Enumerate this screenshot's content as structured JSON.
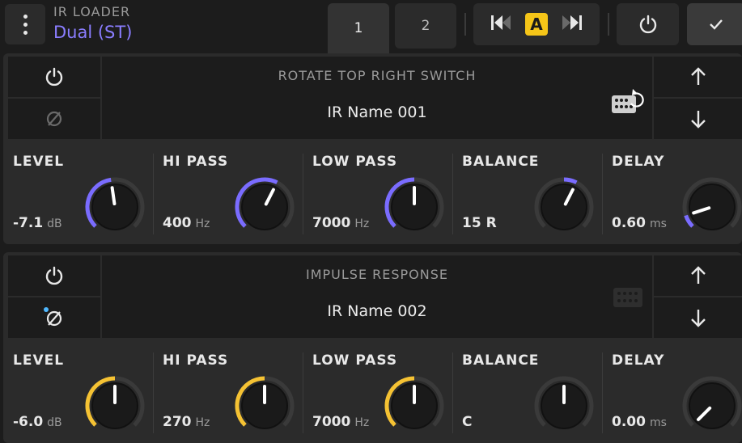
{
  "header": {
    "module_label": "IR LOADER",
    "module_type": "Dual (ST)",
    "tabs": [
      {
        "label": "1",
        "active": true
      },
      {
        "label": "2",
        "active": false
      }
    ],
    "preset_badge": "A"
  },
  "slots": [
    {
      "section_label": "ROTATE TOP RIGHT SWITCH",
      "ir_name": "IR Name 001",
      "phase_active": false,
      "accent": "#7a6cff",
      "knobs": [
        {
          "label": "LEVEL",
          "value": "-7.1",
          "unit": "dB",
          "level": 0.47
        },
        {
          "label": "HI PASS",
          "value": "400",
          "unit": "Hz",
          "level": 0.6
        },
        {
          "label": "LOW PASS",
          "value": "7000",
          "unit": "Hz",
          "level": 0.5
        },
        {
          "label": "BALANCE",
          "value": "15 R",
          "unit": "",
          "level": 0.6
        },
        {
          "label": "DELAY",
          "value": "0.60",
          "unit": "ms",
          "level": 0.1
        }
      ]
    },
    {
      "section_label": "IMPULSE RESPONSE",
      "ir_name": "IR Name 002",
      "phase_active": true,
      "accent": "#f5c233",
      "knobs": [
        {
          "label": "LEVEL",
          "value": "-6.0",
          "unit": "dB",
          "level": 0.5
        },
        {
          "label": "HI PASS",
          "value": "270",
          "unit": "Hz",
          "level": 0.5
        },
        {
          "label": "LOW PASS",
          "value": "7000",
          "unit": "Hz",
          "level": 0.5
        },
        {
          "label": "BALANCE",
          "value": "C",
          "unit": "",
          "level": 0.5
        },
        {
          "label": "DELAY",
          "value": "0.00",
          "unit": "ms",
          "level": 0.0
        }
      ]
    }
  ]
}
